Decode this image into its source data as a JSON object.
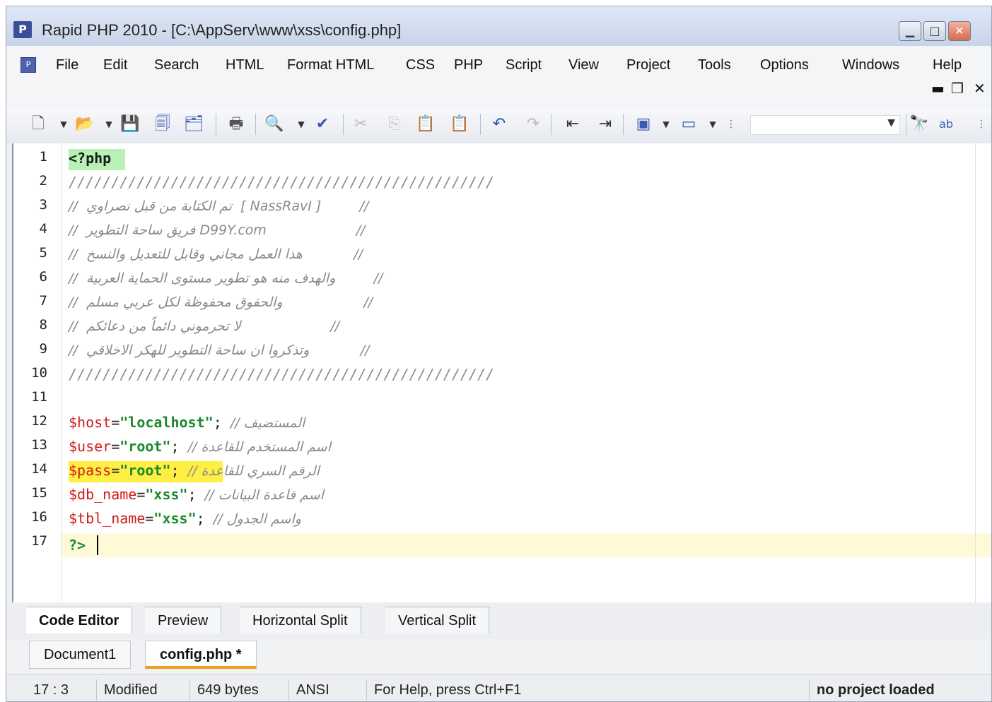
{
  "window": {
    "title": "Rapid PHP 2010 - [C:\\AppServ\\www\\xss\\config.php]"
  },
  "menubar": {
    "items": [
      "File",
      "Edit",
      "Search",
      "HTML",
      "Format HTML",
      "CSS",
      "PHP",
      "Script",
      "View",
      "Project",
      "Tools",
      "Options",
      "Windows",
      "Help"
    ]
  },
  "toolbar": {
    "search_value": ""
  },
  "editor": {
    "line_numbers": [
      "1",
      "2",
      "3",
      "4",
      "5",
      "6",
      "7",
      "8",
      "9",
      "10",
      "11",
      "12",
      "13",
      "14",
      "15",
      "16",
      "17"
    ],
    "lines": {
      "l1": "<?php",
      "l2": "//////////////////////////////////////////////////",
      "l3": "//  تم الكتابة من قبل نصراوي  [ NassRavI ]         //",
      "l4": "//  فريق ساحة التطوير D99Y.com                     //",
      "l5": "//  هذا العمل مجاني وقابل للتعديل والنسخ            //",
      "l6": "//  والهدف منه هو تطوير مستوى الحماية العربية         //",
      "l7": "//  والحقوق محفوظة لكل عربي مسلم                   //",
      "l8": "//  لا تحرموني دائماً من دعائكم                     //",
      "l9": "//  وتذكروا ان ساحة التطوير للهكر الاخلاقي            //",
      "l10": "//////////////////////////////////////////////////",
      "l11": "",
      "l12_var": "$host",
      "l12_eq": "=",
      "l12_str": "\"localhost\"",
      "l12_semi": ";",
      "l12_cmt": "// المستضيف",
      "l13_var": "$user",
      "l13_eq": "=",
      "l13_str": "\"root\"",
      "l13_semi": ";",
      "l13_cmt": "// اسم المستخدم للقاعدة",
      "l14_var": "$pass",
      "l14_eq": "=",
      "l14_str": "\"root\"",
      "l14_semi": ";",
      "l14_cmt": "// الرقم السري للقاعدة",
      "l15_var": "$db_name",
      "l15_eq": "=",
      "l15_str": "\"xss\"",
      "l15_semi": ";",
      "l15_cmt": "// اسم قاعدة البيانات",
      "l16_var": "$tbl_name",
      "l16_eq": "=",
      "l16_str": "\"xss\"",
      "l16_semi": ";",
      "l16_cmt": "// واسم الجدول",
      "l17": "?>"
    }
  },
  "view_tabs": [
    "Code Editor",
    "Preview",
    "Horizontal Split",
    "Vertical Split"
  ],
  "doc_tabs": [
    "Document1",
    "config.php *"
  ],
  "statusbar": {
    "position": "17 : 3",
    "state": "Modified",
    "size": "649 bytes",
    "encoding": "ANSI",
    "help": "For Help, press Ctrl+F1",
    "project": "no project loaded"
  }
}
